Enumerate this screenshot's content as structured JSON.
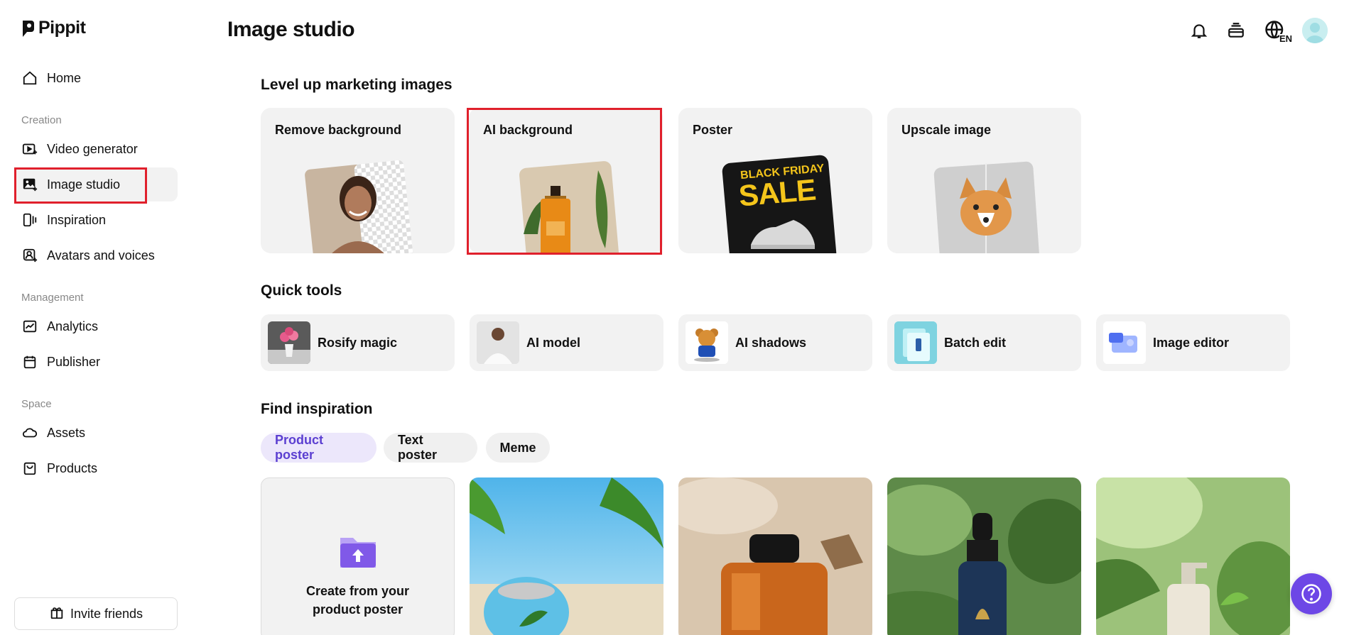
{
  "app": {
    "name": "Pippit"
  },
  "sidebar": {
    "home": "Home",
    "sections": [
      "Creation",
      "Management",
      "Space"
    ],
    "creation": [
      {
        "label": "Video generator"
      },
      {
        "label": "Image studio"
      },
      {
        "label": "Inspiration"
      },
      {
        "label": "Avatars and voices"
      }
    ],
    "management": [
      {
        "label": "Analytics"
      },
      {
        "label": "Publisher"
      }
    ],
    "space": [
      {
        "label": "Assets"
      },
      {
        "label": "Products"
      }
    ],
    "invite_label": "Invite friends"
  },
  "header": {
    "title": "Image studio",
    "lang": "EN"
  },
  "level_up": {
    "title": "Level up marketing images",
    "cards": [
      {
        "label": "Remove background"
      },
      {
        "label": "AI background"
      },
      {
        "label": "Poster",
        "art_text_1": "BLACK FRIDAY",
        "art_text_2": "SALE"
      },
      {
        "label": "Upscale image"
      }
    ]
  },
  "quick_tools": {
    "title": "Quick tools",
    "items": [
      {
        "label": "Rosify magic"
      },
      {
        "label": "AI model"
      },
      {
        "label": "AI shadows"
      },
      {
        "label": "Batch edit"
      },
      {
        "label": "Image editor"
      }
    ]
  },
  "inspiration": {
    "title": "Find inspiration",
    "chips": [
      "Product poster",
      "Text poster",
      "Meme"
    ],
    "create_label_line1": "Create from your",
    "create_label_line2": "product poster"
  },
  "colors": {
    "accent": "#6d47e6",
    "highlight": "#e0202c",
    "chip_active_bg": "#ece7fb"
  }
}
